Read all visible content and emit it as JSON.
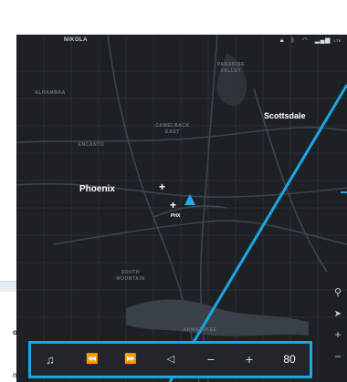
{
  "status_bar": {
    "brand": "NIKOLA",
    "icons": [
      "lock-icon",
      "bluetooth-icon",
      "wifi-icon",
      "signal-icon"
    ],
    "signal_text": "LTE"
  },
  "map": {
    "areas": [
      {
        "key": "paradise_valley",
        "text": "PARADISE\nVALLEY"
      },
      {
        "key": "alhambra",
        "text": "ALHAMBRA"
      },
      {
        "key": "camelback_east",
        "text": "CAMELBACK\nEAST"
      },
      {
        "key": "encanto",
        "text": "ENCANTO"
      },
      {
        "key": "south_mountain",
        "text": "SOUTH\nMOUNTAIN"
      },
      {
        "key": "ahwatukee",
        "text": "AHWATUKEE"
      }
    ],
    "cities": {
      "phoenix": "Phoenix",
      "scottsdale": "Scottsdale"
    },
    "airport": "PHX",
    "colors": {
      "background": "#1d2126",
      "road": "#3a4048",
      "highlight": "#19a7e6",
      "vehicle": "#29a9f0"
    }
  },
  "map_tools": [
    {
      "name": "search-icon",
      "glyph": "⚲"
    },
    {
      "name": "location-icon",
      "glyph": "➤"
    },
    {
      "name": "zoom-in-icon",
      "glyph": "+"
    },
    {
      "name": "zoom-out-icon",
      "glyph": "−"
    }
  ],
  "side_panel": {
    "text_or": "or",
    "text_n": "n"
  },
  "media_bar": {
    "music_icon": "♫",
    "prev_icon": "⏪",
    "next_icon": "⏩",
    "volume_icon": "◁",
    "minus": "−",
    "plus": "+",
    "volume_value": "80"
  }
}
